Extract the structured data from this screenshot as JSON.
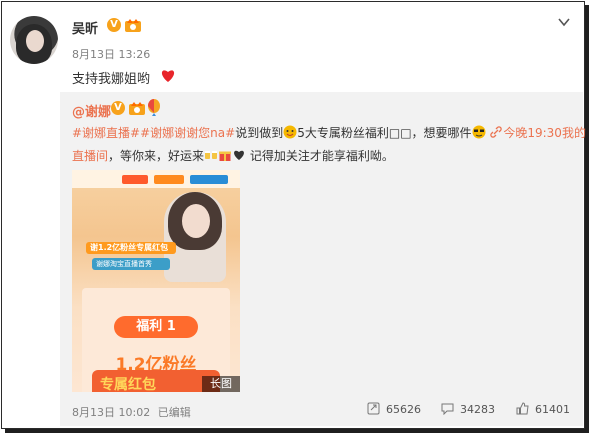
{
  "post": {
    "author": "吴昕",
    "badge_v": "V",
    "time": "8月13日 13:26",
    "text": "支持我娜姐哟"
  },
  "repost": {
    "author": "@谢娜",
    "topic1": "#谢娜直播#",
    "topic2": "#谢娜谢谢您na#",
    "text1": "说到做到",
    "text2": "5大专属粉丝福利□□，想要哪件",
    "link_text": "今晚19:30我的",
    "link_text2": "直播间",
    "text3": "，等你来，好运来",
    "text4": "记得加关注才能享福利呦。",
    "image": {
      "banner1": "谢1.2亿粉丝专属红包",
      "banner2": "谢娜淘宝直播首秀",
      "fuli": "福利 1",
      "big_text": "1.2亿粉丝",
      "red_text": "专属红包",
      "long_image_tag": "长图"
    },
    "footer": {
      "time": "8月13日 10:02",
      "edited": "已编辑",
      "reposts": "65626",
      "comments": "34283",
      "likes": "61401"
    }
  },
  "colors": {
    "accent": "#eb7350",
    "badge": "#f7a21b"
  },
  "icons": [
    "chevron-down-icon",
    "verified-icon",
    "vip-crown-icon",
    "heart-icon",
    "balloon-icon",
    "link-icon",
    "repost-icon",
    "comment-icon",
    "like-icon"
  ]
}
